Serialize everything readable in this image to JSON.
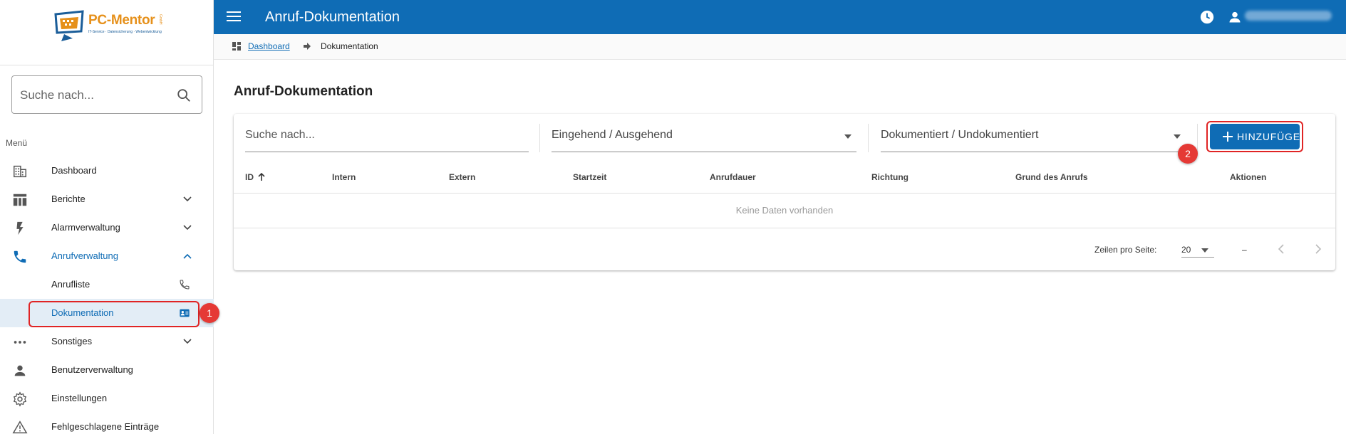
{
  "logo": {
    "title": "PC-Mentor",
    "subtitle": "IT-Service · Datensicherung · Webentwicklung",
    "vertical": "GmbH"
  },
  "sidebar": {
    "search_placeholder": "Suche nach...",
    "menu_label": "Menü",
    "items": [
      {
        "label": "Dashboard",
        "icon": "building-icon"
      },
      {
        "label": "Berichte",
        "icon": "reports-icon"
      },
      {
        "label": "Alarmverwaltung",
        "icon": "bolt-icon"
      },
      {
        "label": "Anrufverwaltung",
        "icon": "phone-icon"
      },
      {
        "label": "Anrufliste",
        "icon": "phone-small-icon"
      },
      {
        "label": "Dokumentation",
        "icon": "contact-card-icon"
      },
      {
        "label": "Sonstiges",
        "icon": "more-icon"
      },
      {
        "label": "Benutzerverwaltung",
        "icon": "person-icon"
      },
      {
        "label": "Einstellungen",
        "icon": "gear-icon"
      },
      {
        "label": "Fehlgeschlagene Einträge",
        "icon": "warning-icon"
      }
    ]
  },
  "topbar": {
    "title": "Anruf-Dokumentation"
  },
  "breadcrumb": {
    "root": "Dashboard",
    "current": "Dokumentation"
  },
  "page": {
    "title": "Anruf-Dokumentation"
  },
  "filters": {
    "search_placeholder": "Suche nach...",
    "direction": "Eingehend / Ausgehend",
    "documented": "Dokumentiert / Undokumentiert"
  },
  "add_button": "HINZUFÜGEN",
  "table": {
    "columns": [
      "ID",
      "Intern",
      "Extern",
      "Startzeit",
      "Anrufdauer",
      "Richtung",
      "Grund des Anrufs",
      "Aktionen"
    ],
    "empty": "Keine Daten vorhanden"
  },
  "pagination": {
    "rows_label": "Zeilen pro Seite:",
    "rows_value": "20",
    "range": "–"
  },
  "annotations": [
    "1",
    "2"
  ],
  "colors": {
    "primary": "#0f6cb5",
    "annotation": "#e53935"
  }
}
